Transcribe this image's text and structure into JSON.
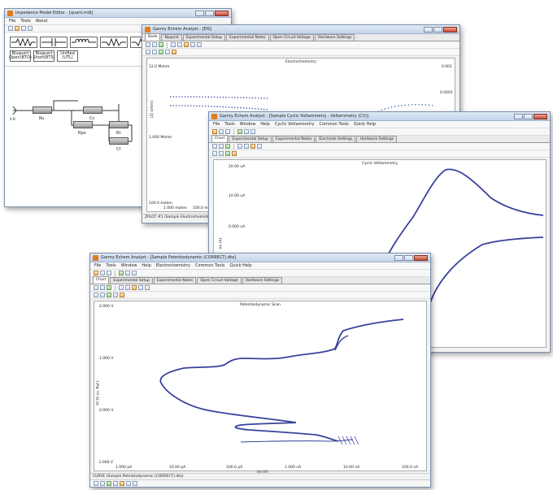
{
  "model_editor": {
    "title": "Impedance Model Editor - [quant.mdl]",
    "menu": [
      "File",
      "Tools",
      "About"
    ],
    "buttons": [
      "Bisquert Open(BTO)",
      "Bisquert Short(BTS)",
      "Unified (UTL)"
    ],
    "labels": {
      "ru": "Ru",
      "cc": "Cc",
      "rpo": "Rpo",
      "rt": "Rt",
      "cf": "Cf",
      "node": "A B"
    }
  },
  "win2": {
    "title": "Gamry Echem Analyst - [EIS]",
    "tabs": [
      "Bode",
      "Nyquist",
      "Experimental Setup",
      "Experimental Notes",
      "Open Circuit Voltage",
      "Hardware Settings"
    ],
    "plot_title": "Electrochemistry",
    "tick_left_top": "12.0 Mohm",
    "tick_left_mid": "1.000 Mohm",
    "tick_left_bottom": "100.0 mohm",
    "tick_bottom_1": "1.000 mohm",
    "tick_bottom_2": "100.0 mohm",
    "tick_right_top": "0.001",
    "tick_right_mid": "0.0001",
    "axis_label": "|Z| (ohm)",
    "status": "ZPLOT #1 (Sample Electrochemistry EIS.DTA)"
  },
  "win3": {
    "title": "Gamry Echem Analyst - [Sample Cyclic Voltammetry - Voltammetry (CV)]",
    "menu": [
      "File",
      "Tools",
      "Window",
      "Help",
      "Cyclic Voltammetry",
      "Common Tools",
      "Quick Help"
    ],
    "tabs": [
      "Chart",
      "Experimental Setup",
      "Experimental Notes",
      "Electrode Settings",
      "Hardware Settings"
    ],
    "plot_title": "Cyclic Voltammetry",
    "ylabel": "Im (A)",
    "ticks_y": [
      "20.00 uA",
      "10.00 uA",
      "0.000 uA"
    ]
  },
  "win4": {
    "title": "Gamry Echem Analyst - [Sample Potentiodynamic (CORRECT).dta]",
    "menu": [
      "File",
      "Tools",
      "Window",
      "Help",
      "Electrochemistry",
      "Common Tools",
      "Quick Help"
    ],
    "tabs": [
      "Chart",
      "Experimental Setup",
      "Experimental Notes",
      "Open Circuit Voltage",
      "Hardware Settings"
    ],
    "plot_title": "Potentiodynamic Scan",
    "ylabel": "Vf (V vs. Ref.)",
    "xlabel": "Im (A)",
    "ticks_y": [
      "2.000 V",
      "1.000 V",
      "0.000 V",
      "-1.000 V"
    ],
    "ticks_x": [
      "1.000 pA",
      "10.00 pA",
      "100.0 pA",
      "1.000 nA",
      "10.00 nA",
      "100.0 nA"
    ],
    "status": "CURVE (Sample Potentiodynamic (CORRECT).dta)"
  },
  "colors": {
    "curve": "#39429c",
    "dotted": "#2b3aa0",
    "titlebar": "#c3d4e9",
    "accent": "#e07b1f"
  }
}
